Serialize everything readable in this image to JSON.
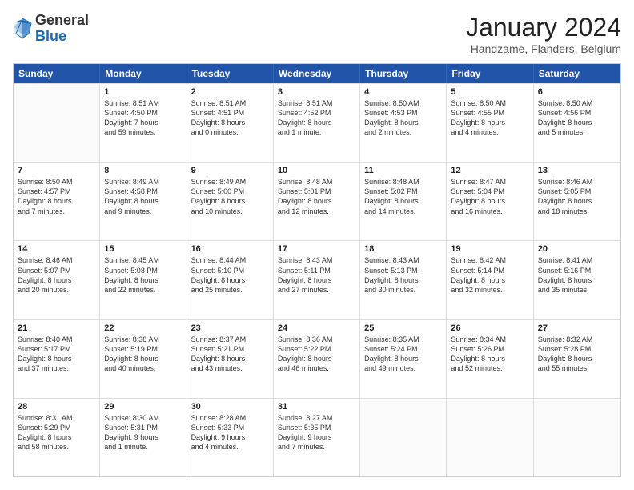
{
  "header": {
    "logo": {
      "general": "General",
      "blue": "Blue"
    },
    "title": "January 2024",
    "subtitle": "Handzame, Flanders, Belgium"
  },
  "days": [
    "Sunday",
    "Monday",
    "Tuesday",
    "Wednesday",
    "Thursday",
    "Friday",
    "Saturday"
  ],
  "rows": [
    [
      {
        "day": "",
        "info": ""
      },
      {
        "day": "1",
        "info": "Sunrise: 8:51 AM\nSunset: 4:50 PM\nDaylight: 7 hours\nand 59 minutes."
      },
      {
        "day": "2",
        "info": "Sunrise: 8:51 AM\nSunset: 4:51 PM\nDaylight: 8 hours\nand 0 minutes."
      },
      {
        "day": "3",
        "info": "Sunrise: 8:51 AM\nSunset: 4:52 PM\nDaylight: 8 hours\nand 1 minute."
      },
      {
        "day": "4",
        "info": "Sunrise: 8:50 AM\nSunset: 4:53 PM\nDaylight: 8 hours\nand 2 minutes."
      },
      {
        "day": "5",
        "info": "Sunrise: 8:50 AM\nSunset: 4:55 PM\nDaylight: 8 hours\nand 4 minutes."
      },
      {
        "day": "6",
        "info": "Sunrise: 8:50 AM\nSunset: 4:56 PM\nDaylight: 8 hours\nand 5 minutes."
      }
    ],
    [
      {
        "day": "7",
        "info": "Sunrise: 8:50 AM\nSunset: 4:57 PM\nDaylight: 8 hours\nand 7 minutes."
      },
      {
        "day": "8",
        "info": "Sunrise: 8:49 AM\nSunset: 4:58 PM\nDaylight: 8 hours\nand 9 minutes."
      },
      {
        "day": "9",
        "info": "Sunrise: 8:49 AM\nSunset: 5:00 PM\nDaylight: 8 hours\nand 10 minutes."
      },
      {
        "day": "10",
        "info": "Sunrise: 8:48 AM\nSunset: 5:01 PM\nDaylight: 8 hours\nand 12 minutes."
      },
      {
        "day": "11",
        "info": "Sunrise: 8:48 AM\nSunset: 5:02 PM\nDaylight: 8 hours\nand 14 minutes."
      },
      {
        "day": "12",
        "info": "Sunrise: 8:47 AM\nSunset: 5:04 PM\nDaylight: 8 hours\nand 16 minutes."
      },
      {
        "day": "13",
        "info": "Sunrise: 8:46 AM\nSunset: 5:05 PM\nDaylight: 8 hours\nand 18 minutes."
      }
    ],
    [
      {
        "day": "14",
        "info": "Sunrise: 8:46 AM\nSunset: 5:07 PM\nDaylight: 8 hours\nand 20 minutes."
      },
      {
        "day": "15",
        "info": "Sunrise: 8:45 AM\nSunset: 5:08 PM\nDaylight: 8 hours\nand 22 minutes."
      },
      {
        "day": "16",
        "info": "Sunrise: 8:44 AM\nSunset: 5:10 PM\nDaylight: 8 hours\nand 25 minutes."
      },
      {
        "day": "17",
        "info": "Sunrise: 8:43 AM\nSunset: 5:11 PM\nDaylight: 8 hours\nand 27 minutes."
      },
      {
        "day": "18",
        "info": "Sunrise: 8:43 AM\nSunset: 5:13 PM\nDaylight: 8 hours\nand 30 minutes."
      },
      {
        "day": "19",
        "info": "Sunrise: 8:42 AM\nSunset: 5:14 PM\nDaylight: 8 hours\nand 32 minutes."
      },
      {
        "day": "20",
        "info": "Sunrise: 8:41 AM\nSunset: 5:16 PM\nDaylight: 8 hours\nand 35 minutes."
      }
    ],
    [
      {
        "day": "21",
        "info": "Sunrise: 8:40 AM\nSunset: 5:17 PM\nDaylight: 8 hours\nand 37 minutes."
      },
      {
        "day": "22",
        "info": "Sunrise: 8:38 AM\nSunset: 5:19 PM\nDaylight: 8 hours\nand 40 minutes."
      },
      {
        "day": "23",
        "info": "Sunrise: 8:37 AM\nSunset: 5:21 PM\nDaylight: 8 hours\nand 43 minutes."
      },
      {
        "day": "24",
        "info": "Sunrise: 8:36 AM\nSunset: 5:22 PM\nDaylight: 8 hours\nand 46 minutes."
      },
      {
        "day": "25",
        "info": "Sunrise: 8:35 AM\nSunset: 5:24 PM\nDaylight: 8 hours\nand 49 minutes."
      },
      {
        "day": "26",
        "info": "Sunrise: 8:34 AM\nSunset: 5:26 PM\nDaylight: 8 hours\nand 52 minutes."
      },
      {
        "day": "27",
        "info": "Sunrise: 8:32 AM\nSunset: 5:28 PM\nDaylight: 8 hours\nand 55 minutes."
      }
    ],
    [
      {
        "day": "28",
        "info": "Sunrise: 8:31 AM\nSunset: 5:29 PM\nDaylight: 8 hours\nand 58 minutes."
      },
      {
        "day": "29",
        "info": "Sunrise: 8:30 AM\nSunset: 5:31 PM\nDaylight: 9 hours\nand 1 minute."
      },
      {
        "day": "30",
        "info": "Sunrise: 8:28 AM\nSunset: 5:33 PM\nDaylight: 9 hours\nand 4 minutes."
      },
      {
        "day": "31",
        "info": "Sunrise: 8:27 AM\nSunset: 5:35 PM\nDaylight: 9 hours\nand 7 minutes."
      },
      {
        "day": "",
        "info": ""
      },
      {
        "day": "",
        "info": ""
      },
      {
        "day": "",
        "info": ""
      }
    ]
  ]
}
